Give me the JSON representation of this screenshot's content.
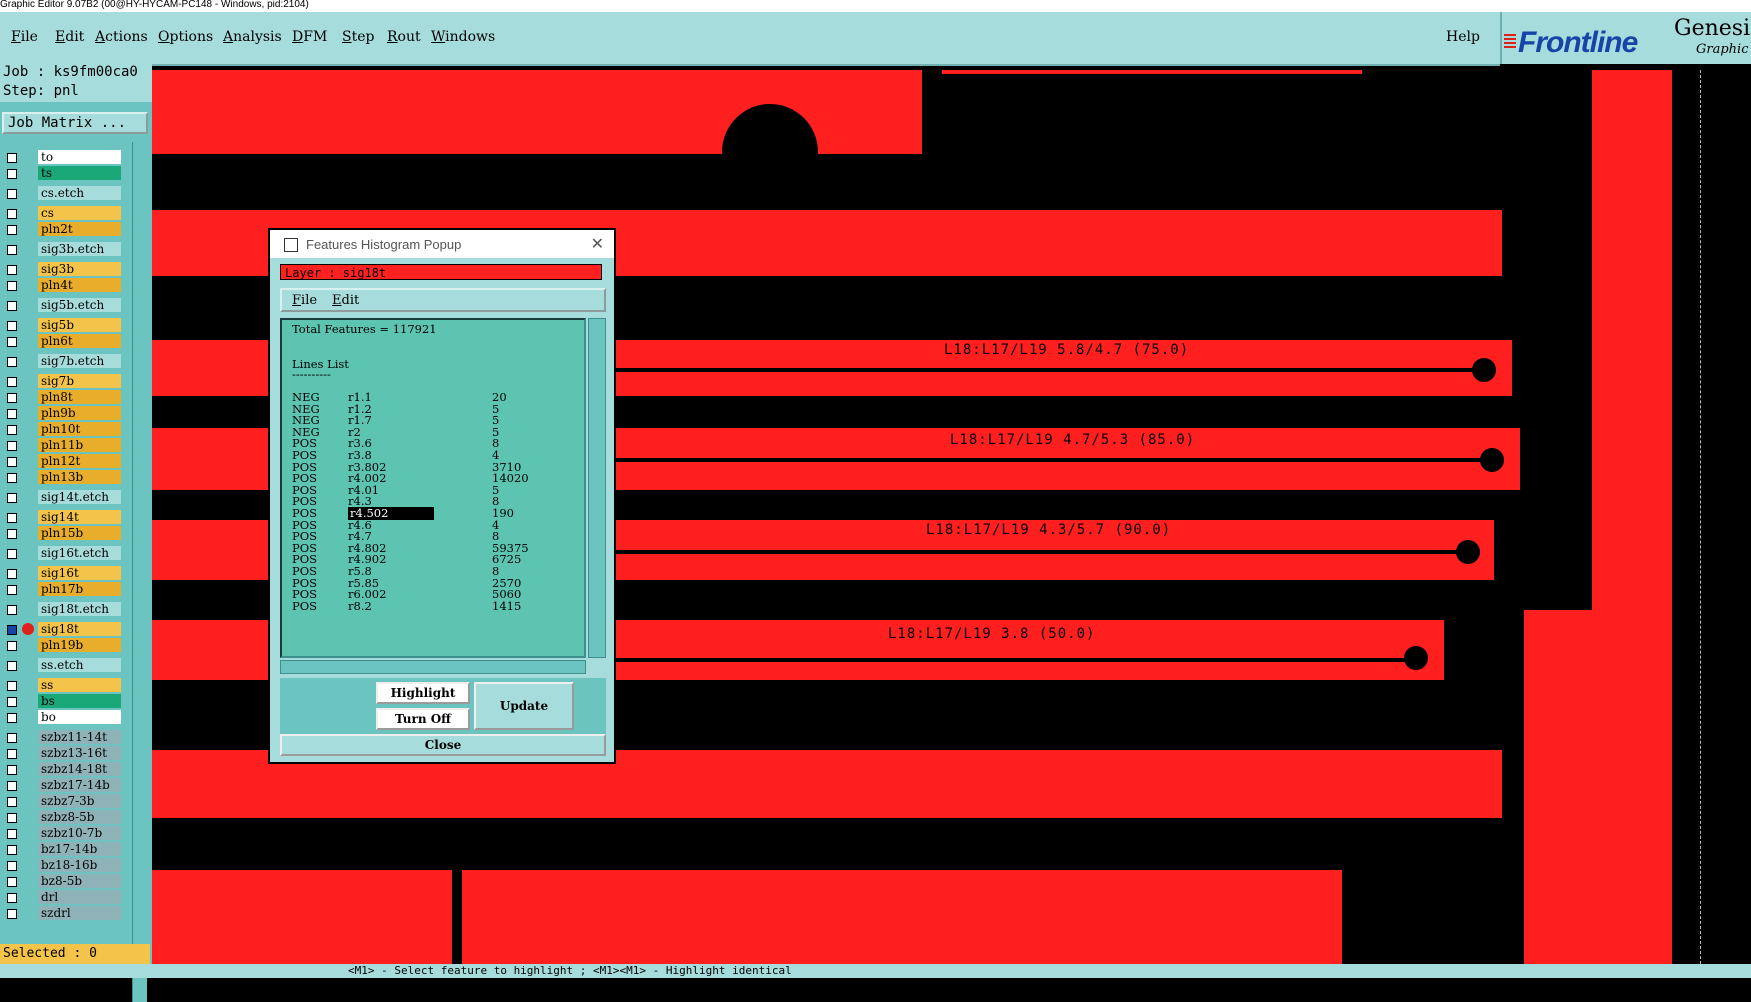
{
  "window": {
    "title": "Graphic Editor 9.07B2 (00@HY-HYCAM-PC148 - Windows, pid:2104)"
  },
  "menu": {
    "items": [
      {
        "label": "File",
        "ul": "F",
        "rest": "ile"
      },
      {
        "label": "Edit",
        "ul": "E",
        "rest": "dit"
      },
      {
        "label": "Actions",
        "ul": "A",
        "rest": "ctions"
      },
      {
        "label": "Options",
        "ul": "O",
        "rest": "ptions"
      },
      {
        "label": "Analysis",
        "ul": "A",
        "rest": "nalysis"
      },
      {
        "label": "DFM",
        "ul": "D",
        "rest": "FM"
      },
      {
        "label": "Step",
        "ul": "S",
        "rest": "tep"
      },
      {
        "label": "Rout",
        "ul": "R",
        "rest": "out"
      },
      {
        "label": "Windows",
        "ul": "W",
        "rest": "indows"
      }
    ],
    "help": "Help"
  },
  "brand": {
    "logo": "Frontline",
    "product": "Genesis",
    "subtitle": "Graphic E"
  },
  "job": {
    "job_line": "Job : ks9fm00ca0",
    "step_line": "Step: pnl",
    "matrix_button": "Job Matrix ..."
  },
  "layers": [
    {
      "name": "to",
      "color": "#ffffff"
    },
    {
      "name": "ts",
      "color": "#1aa878"
    },
    {
      "name": "cs.etch",
      "color": "#a7dcdc"
    },
    {
      "name": "cs",
      "color": "#f4c44a"
    },
    {
      "name": "pln2t",
      "color": "#e8ad2a"
    },
    {
      "name": "sig3b.etch",
      "color": "#a7dcdc"
    },
    {
      "name": "sig3b",
      "color": "#f4c44a"
    },
    {
      "name": "pln4t",
      "color": "#e8ad2a"
    },
    {
      "name": "sig5b.etch",
      "color": "#a7dcdc"
    },
    {
      "name": "sig5b",
      "color": "#f4c44a"
    },
    {
      "name": "pln6t",
      "color": "#e8ad2a"
    },
    {
      "name": "sig7b.etch",
      "color": "#a7dcdc"
    },
    {
      "name": "sig7b",
      "color": "#f4c44a"
    },
    {
      "name": "pln8t",
      "color": "#e8ad2a"
    },
    {
      "name": "pln9b",
      "color": "#e8ad2a"
    },
    {
      "name": "pln10t",
      "color": "#e8ad2a"
    },
    {
      "name": "pln11b",
      "color": "#e8ad2a"
    },
    {
      "name": "pln12t",
      "color": "#e8ad2a"
    },
    {
      "name": "pln13b",
      "color": "#e8ad2a"
    },
    {
      "name": "sig14t.etch",
      "color": "#a7dcdc"
    },
    {
      "name": "sig14t",
      "color": "#f4c44a"
    },
    {
      "name": "pln15b",
      "color": "#e8ad2a"
    },
    {
      "name": "sig16t.etch",
      "color": "#a7dcdc"
    },
    {
      "name": "sig16t",
      "color": "#f4c44a"
    },
    {
      "name": "pln17b",
      "color": "#e8ad2a"
    },
    {
      "name": "sig18t.etch",
      "color": "#a7dcdc"
    },
    {
      "name": "sig18t",
      "color": "#f4c44a"
    },
    {
      "name": "pln19b",
      "color": "#e8ad2a"
    },
    {
      "name": "ss.etch",
      "color": "#a7dcdc"
    },
    {
      "name": "ss",
      "color": "#f4c44a"
    },
    {
      "name": "bs",
      "color": "#1aa878"
    },
    {
      "name": "bo",
      "color": "#ffffff"
    },
    {
      "name": "szbz11-14t",
      "color": "#8fb2b8"
    },
    {
      "name": "szbz13-16t",
      "color": "#8fb2b8"
    },
    {
      "name": "szbz14-18t",
      "color": "#8fb2b8"
    },
    {
      "name": "szbz17-14b",
      "color": "#8fb2b8"
    },
    {
      "name": "szbz7-3b",
      "color": "#8fb2b8"
    },
    {
      "name": "szbz8-5b",
      "color": "#8fb2b8"
    },
    {
      "name": "szbz10-7b",
      "color": "#8fb2b8"
    },
    {
      "name": "bz17-14b",
      "color": "#8fb2b8"
    },
    {
      "name": "bz18-16b",
      "color": "#8fb2b8"
    },
    {
      "name": "bz8-5b",
      "color": "#8fb2b8"
    },
    {
      "name": "drl",
      "color": "#8fb2b8"
    },
    {
      "name": "szdrl",
      "color": "#8fb2b8"
    }
  ],
  "selected_text": "Selected : 0",
  "status_text": "<M1> - Select feature to highlight ; <M1><M1> - Highlight identical",
  "canvas_labels": [
    "L18:L17/L19 5.8/4.7 (75.0)",
    "L18:L17/L19 4.7/5.3 (85.0)",
    "L18:L17/L19 4.3/5.7 (90.0)",
    "L18:L17/L19 3.8 (50.0)"
  ],
  "popup": {
    "title": "Features Histogram Popup",
    "layer_line": "Layer :  sig18t",
    "menu": [
      {
        "ul": "F",
        "rest": "ile"
      },
      {
        "ul": "E",
        "rest": "dit"
      }
    ],
    "total": "Total Features = 117921",
    "section": "Lines List",
    "divider": "----------",
    "rows": [
      [
        "NEG",
        "r1.1",
        "20"
      ],
      [
        "NEG",
        "r1.2",
        "5"
      ],
      [
        "NEG",
        "r1.7",
        "5"
      ],
      [
        "NEG",
        "r2",
        "5"
      ],
      [
        "POS",
        "r3.6",
        "8"
      ],
      [
        "POS",
        "r3.8",
        "4"
      ],
      [
        "POS",
        "r3.802",
        "3710"
      ],
      [
        "POS",
        "r4.002",
        "14020"
      ],
      [
        "POS",
        "r4.01",
        "5"
      ],
      [
        "POS",
        "r4.3",
        "8"
      ],
      [
        "POS",
        "r4.502",
        "190"
      ],
      [
        "POS",
        "r4.6",
        "4"
      ],
      [
        "POS",
        "r4.7",
        "8"
      ],
      [
        "POS",
        "r4.802",
        "59375"
      ],
      [
        "POS",
        "r4.902",
        "6725"
      ],
      [
        "POS",
        "r5.8",
        "8"
      ],
      [
        "POS",
        "r5.85",
        "2570"
      ],
      [
        "POS",
        "r6.002",
        "5060"
      ],
      [
        "POS",
        "r8.2",
        "1415"
      ]
    ],
    "selected_row": 10,
    "buttons": {
      "highlight": "Highlight",
      "turn_off": "Turn Off",
      "update": "Update",
      "close": "Close"
    }
  }
}
